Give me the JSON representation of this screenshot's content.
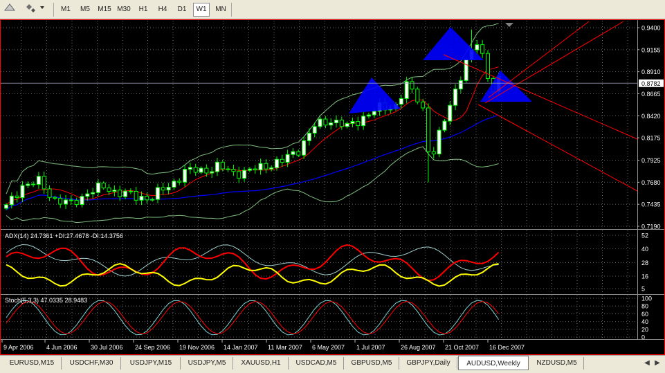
{
  "toolbar": {
    "icons": [
      "triangle-up-icon",
      "shapes-dropdown-icon"
    ],
    "timeframes": [
      "M1",
      "M5",
      "M15",
      "M30",
      "H1",
      "H4",
      "D1",
      "W1",
      "MN"
    ],
    "active_timeframe": "W1"
  },
  "chart": {
    "symbol": "AUDUSD",
    "timeframe": "Weekly",
    "price_axis": [
      "0.9400",
      "0.9155",
      "0.8910",
      "0.8665",
      "0.8420",
      "0.8175",
      "0.7925",
      "0.7680",
      "0.7435",
      "0.7190"
    ],
    "current_price": "0.8782",
    "dates": [
      "9 Apr 2006",
      "4 Jun 2006",
      "30 Jul 2006",
      "24 Sep 2006",
      "19 Nov 2006",
      "14 Jan 2007",
      "11 Mar 2007",
      "6 May 2007",
      "1 Jul 2007",
      "26 Aug 2007",
      "21 Oct 2007",
      "16 Dec 2007"
    ],
    "colors": {
      "background": "#000000",
      "bull_candle": "#ffffff",
      "bear_candle": "#00ff00",
      "grid": "#c0c0c0",
      "ma_fast": "#ff0000",
      "ma_slow": "#0000ff",
      "bands": "#7fbf7f",
      "pattern": "#0000ff",
      "trendlines": "#ff0000",
      "adx_line": "#ff0000",
      "plus_di": "#a0d0d0",
      "minus_di": "#ffff00",
      "stoch_main": "#7fd0d0",
      "stoch_signal": "#ff0000"
    }
  },
  "adx": {
    "label": "ADX(14) 24.7361 +DI:27.4678 -DI:14.3756",
    "levels": [
      "52",
      "40",
      "28",
      "16",
      "5"
    ]
  },
  "stoch": {
    "label": "Stoch(5,3,3) 47.0335 28.9483",
    "levels": [
      "100",
      "80",
      "60",
      "40",
      "20",
      "0"
    ]
  },
  "tabs": [
    "EURUSD,M15",
    "USDCHF,M30",
    "USDJPY,M15",
    "USDJPY,M5",
    "XAUUSD,H1",
    "USDCAD,M5",
    "GBPUSD,M5",
    "GBPJPY,Daily",
    "AUDUSD,Weekly",
    "NZDUSD,M5"
  ],
  "active_tab": "AUDUSD,Weekly"
}
